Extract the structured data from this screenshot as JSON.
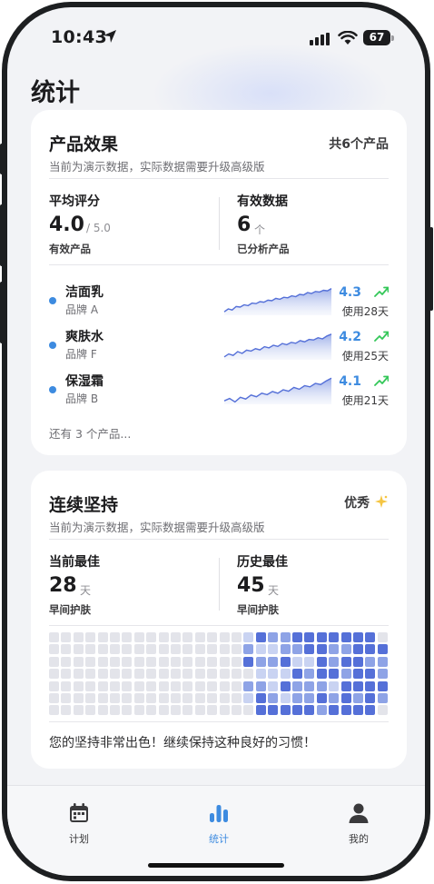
{
  "status_bar": {
    "time": "10:43",
    "battery": "67"
  },
  "page_title": "统计",
  "product_card": {
    "title": "产品效果",
    "subtitle": "当前为演示数据，实际数据需要升级高级版",
    "count_label": "共6个产品",
    "avg": {
      "label": "平均评分",
      "value": "4.0",
      "unit": "/ 5.0",
      "sub": "有效产品"
    },
    "valid": {
      "label": "有效数据",
      "value": "6",
      "unit": "个",
      "sub": "已分析产品"
    },
    "items": [
      {
        "name": "洁面乳",
        "brand": "品牌 A",
        "rating": "4.3",
        "days": "使用28天",
        "trend": [
          0.12,
          0.22,
          0.18,
          0.3,
          0.28,
          0.36,
          0.33,
          0.42,
          0.4,
          0.47,
          0.45,
          0.52,
          0.5,
          0.58,
          0.55,
          0.62,
          0.6,
          0.67,
          0.64,
          0.72,
          0.7,
          0.78,
          0.75,
          0.82,
          0.8,
          0.86,
          0.84,
          0.92
        ]
      },
      {
        "name": "爽肤水",
        "brand": "品牌 F",
        "rating": "4.2",
        "days": "使用25天",
        "trend": [
          0.1,
          0.2,
          0.15,
          0.28,
          0.22,
          0.33,
          0.3,
          0.38,
          0.34,
          0.45,
          0.41,
          0.5,
          0.46,
          0.56,
          0.52,
          0.6,
          0.57,
          0.66,
          0.62,
          0.7,
          0.68,
          0.76,
          0.72,
          0.82,
          0.88
        ]
      },
      {
        "name": "保湿霜",
        "brand": "品牌 B",
        "rating": "4.1",
        "days": "使用21天",
        "trend": [
          0.12,
          0.2,
          0.08,
          0.24,
          0.18,
          0.32,
          0.26,
          0.38,
          0.33,
          0.44,
          0.38,
          0.5,
          0.45,
          0.58,
          0.52,
          0.64,
          0.6,
          0.72,
          0.68,
          0.8,
          0.9
        ]
      }
    ],
    "more": "还有 3 个产品..."
  },
  "streak_card": {
    "title": "连续坚持",
    "subtitle": "当前为演示数据，实际数据需要升级高级版",
    "badge": "优秀",
    "current": {
      "label": "当前最佳",
      "value": "28",
      "unit": "天",
      "sub": "早间护肤"
    },
    "best": {
      "label": "历史最佳",
      "value": "45",
      "unit": "天",
      "sub": "早间护肤"
    },
    "message": "您的坚持非常出色！继续保持这种良好的习惯！",
    "heatmap_rows": [
      "0000000000000000132233333330",
      "0000000000000000211223322333",
      "0000000000000000322311323322",
      "0000000000000000011132332332",
      "0000000000000000221322213333",
      "0000000000000000132122323232",
      "0000000000000000033333233330"
    ]
  },
  "colors": {
    "accent": "#3d8be0",
    "dot": "#3d8be0",
    "trend_up": "#34c759",
    "heat_empty": "#e3e4ea",
    "heat_light": "#c9d3f2",
    "heat_mid": "#8ea3e6",
    "heat_dark": "#5570d8"
  },
  "tabs": [
    {
      "label": "计划",
      "icon": "calendar-icon",
      "active": false
    },
    {
      "label": "统计",
      "icon": "chart-bar-icon",
      "active": true
    },
    {
      "label": "我的",
      "icon": "person-icon",
      "active": false
    }
  ]
}
